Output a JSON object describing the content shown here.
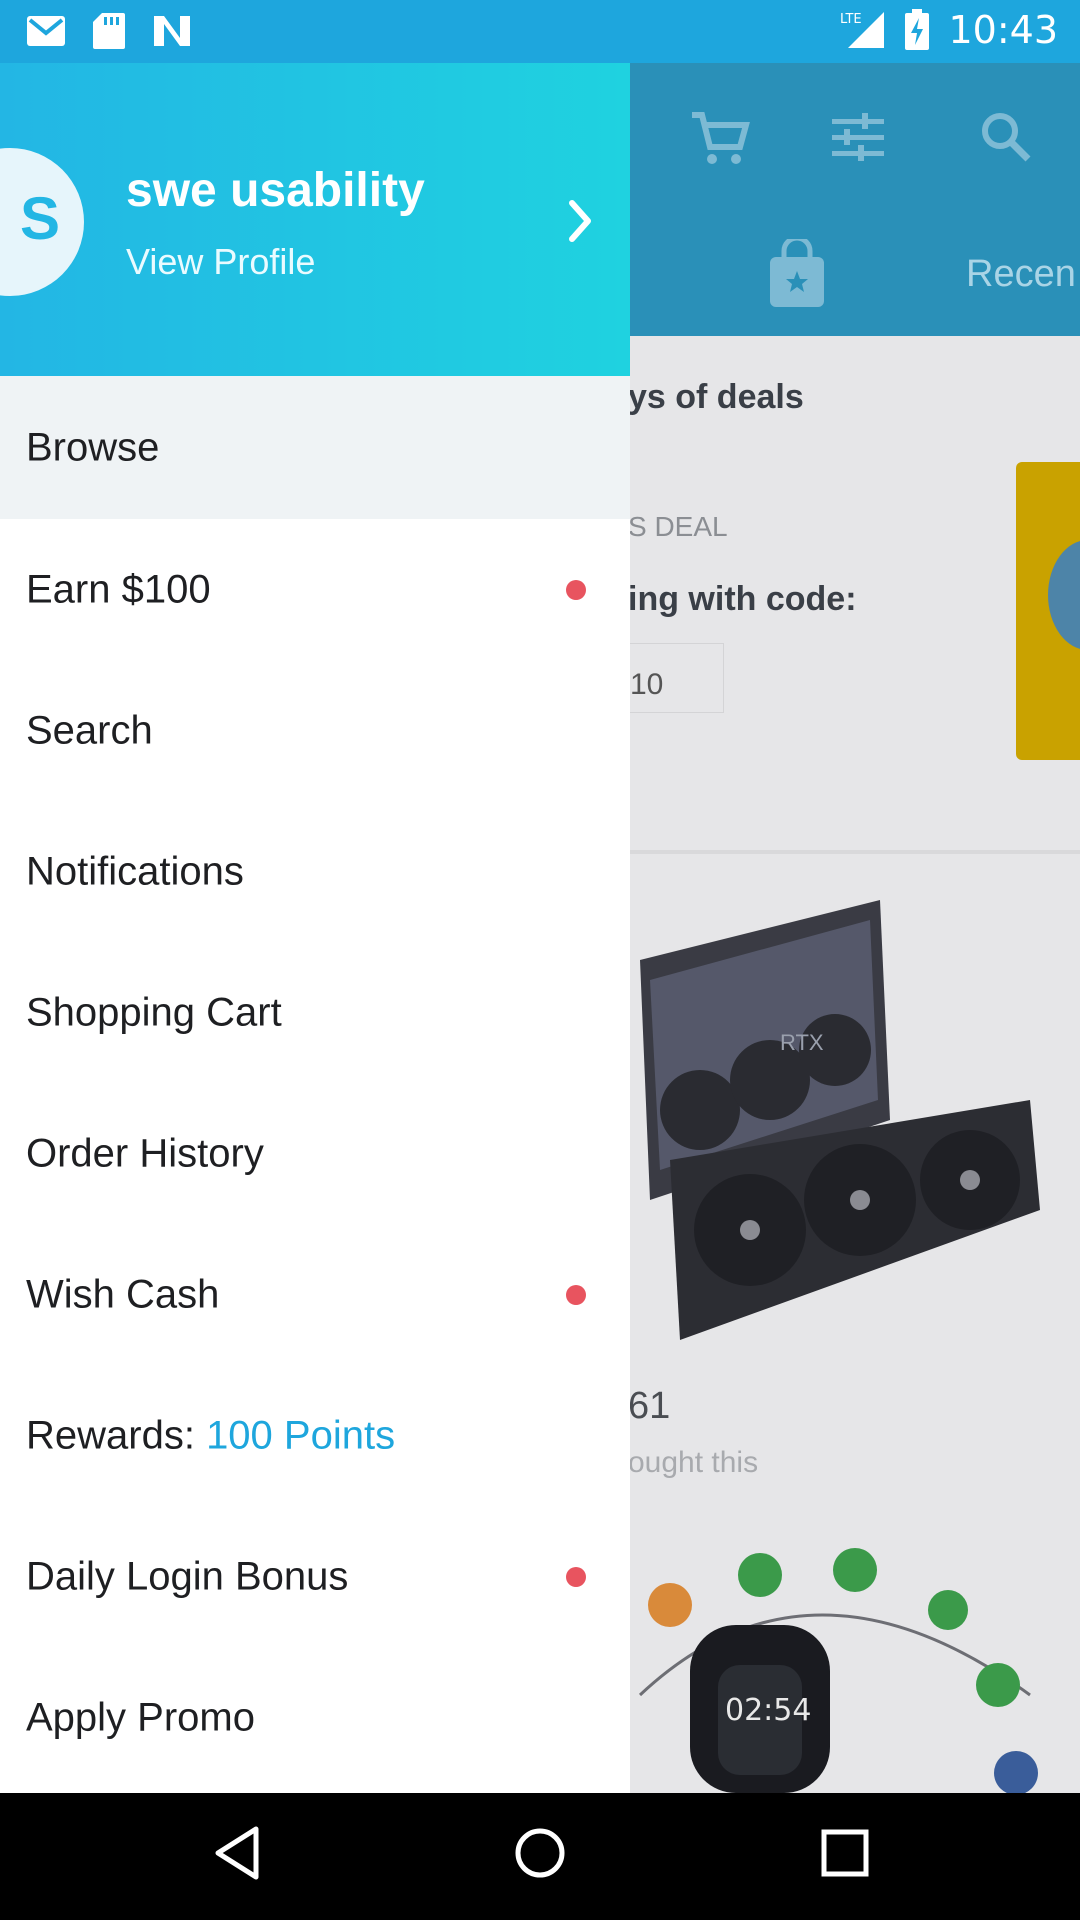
{
  "status_bar": {
    "time": "10:43",
    "network": "LTE",
    "left_icons": [
      "gmail-icon",
      "sd-card-icon",
      "n-icon"
    ],
    "right_icons": [
      "signal-icon",
      "battery-charging-icon"
    ]
  },
  "profile": {
    "avatar_letter": "S",
    "name": "swe usability",
    "subtitle": "View Profile"
  },
  "menu": {
    "items": [
      {
        "label": "Browse",
        "dot": false
      },
      {
        "label": "Earn $100",
        "dot": true
      },
      {
        "label": "Search",
        "dot": false
      },
      {
        "label": "Notifications",
        "dot": false
      },
      {
        "label": "Shopping Cart",
        "dot": false
      },
      {
        "label": "Order History",
        "dot": false
      },
      {
        "label": "Wish Cash",
        "dot": true
      },
      {
        "label": "Rewards: ",
        "points": "100 Points",
        "dot": false
      },
      {
        "label": "Daily Login Bonus",
        "dot": true
      },
      {
        "label": "Apply Promo",
        "dot": false
      }
    ]
  },
  "background": {
    "tab_recent": "Recen",
    "deals_title": "ys of deals",
    "deal_label": "S DEAL",
    "code_text": "ing with code:",
    "code_value": "10",
    "price": "61",
    "bought_text": "ought this"
  },
  "colors": {
    "accent": "#1ea6dd",
    "header_gradient_start": "#23b6e4",
    "header_gradient_end": "#1fd2e0",
    "notification_dot": "#e8545f"
  }
}
